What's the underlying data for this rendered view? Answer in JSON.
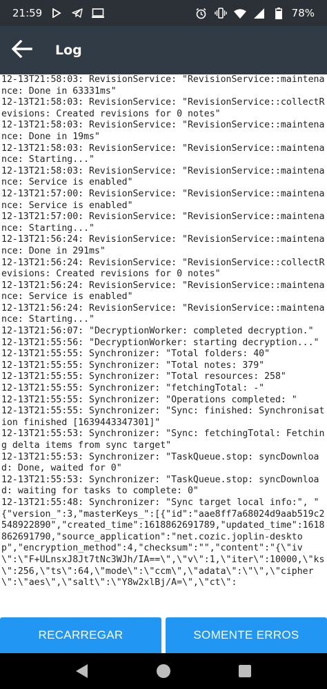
{
  "status_bar": {
    "time": "21:59",
    "battery": "78%",
    "icons_left": [
      "play-icon",
      "telegram-icon",
      "cast-icon"
    ],
    "icons_right": [
      "alarm-icon",
      "vibrate-icon",
      "wifi-icon",
      "signal-icon",
      "battery-icon"
    ]
  },
  "app_bar": {
    "title": "Log",
    "back_icon": "arrow-back-icon"
  },
  "log": {
    "entries": [
      "12-13T21:58:03: RevisionService: \"RevisionService::maintenance: Done in 63331ms\"",
      "12-13T21:58:03: RevisionService: \"RevisionService::collectRevisions: Created revisions for 0 notes\"",
      "12-13T21:58:03: RevisionService: \"RevisionService::maintenance: Done in 19ms\"",
      "12-13T21:58:03: RevisionService: \"RevisionService::maintenance: Starting...\"",
      "12-13T21:58:03: RevisionService: \"RevisionService::maintenance: Service is enabled\"",
      "12-13T21:57:00: RevisionService: \"RevisionService::maintenance: Service is enabled\"",
      "12-13T21:57:00: RevisionService: \"RevisionService::maintenance: Starting...\"",
      "12-13T21:56:24: RevisionService: \"RevisionService::maintenance: Done in 291ms\"",
      "12-13T21:56:24: RevisionService: \"RevisionService::collectRevisions: Created revisions for 0 notes\"",
      "12-13T21:56:24: RevisionService: \"RevisionService::maintenance: Service is enabled\"",
      "12-13T21:56:24: RevisionService: \"RevisionService::maintenance: Starting...\"",
      "12-13T21:56:07: \"DecryptionWorker: completed decryption.\"",
      "12-13T21:55:56: \"DecryptionWorker: starting decryption...\"",
      "12-13T21:55:55: Synchronizer: \"Total folders: 40\"",
      "12-13T21:55:55: Synchronizer: \"Total notes: 379\"",
      "12-13T21:55:55: Synchronizer: \"Total resources: 258\"",
      "12-13T21:55:55: Synchronizer: \"fetchingTotal: -\"",
      "12-13T21:55:55: Synchronizer: \"Operations completed: \"",
      "12-13T21:55:55: Synchronizer: \"Sync: finished: Synchronisation finished [1639443347301]\"",
      "12-13T21:55:53: Synchronizer: \"Sync: fetchingTotal: Fetching delta items from sync target\"",
      "12-13T21:55:53: Synchronizer: \"TaskQueue.stop: syncDownload: Done, waited for 0\"",
      "12-13T21:55:53: Synchronizer: \"TaskQueue.stop: syncDownload: waiting for tasks to complete: 0\"",
      "12-13T21:55:48: Synchronizer: \"Sync target local info:\", \"{\"version_\":3,\"masterKeys_\":[{\"id\":\"aae8ff7a68024d9aab519c2548922890\",\"created_time\":1618862691789,\"updated_time\":1618862691790,\"source_application\":\"net.cozic.joplin-desktop\",\"encryption_method\":4,\"checksum\":\"\",\"content\":\"{\\\"iv\\\":\\\"F+ULnsxJ8Jt7tNc3WJh/IA==\\\",\\\"v\\\":1,\\\"iter\\\":10000,\\\"ks\\\":256,\\\"ts\\\":64,\\\"mode\\\":\\\"ccm\\\",\\\"adata\\\":\\\"\\\",\\\"cipher\\\":\\\"aes\\\",\\\"salt\\\":\\\"Y8w2xlBj/A=\\\",\\\"ct\\\":"
    ]
  },
  "buttons": {
    "reload": "RECARREGAR",
    "errors_only": "SOMENTE ERROS"
  },
  "nav": {
    "back_icon": "nav-back-icon",
    "home_icon": "nav-home-icon",
    "recents_icon": "nav-recents-icon"
  },
  "colors": {
    "status_bar": "#2b3137",
    "app_bar": "#313b45",
    "button": "#2196f3",
    "nav_bar": "#000000"
  }
}
